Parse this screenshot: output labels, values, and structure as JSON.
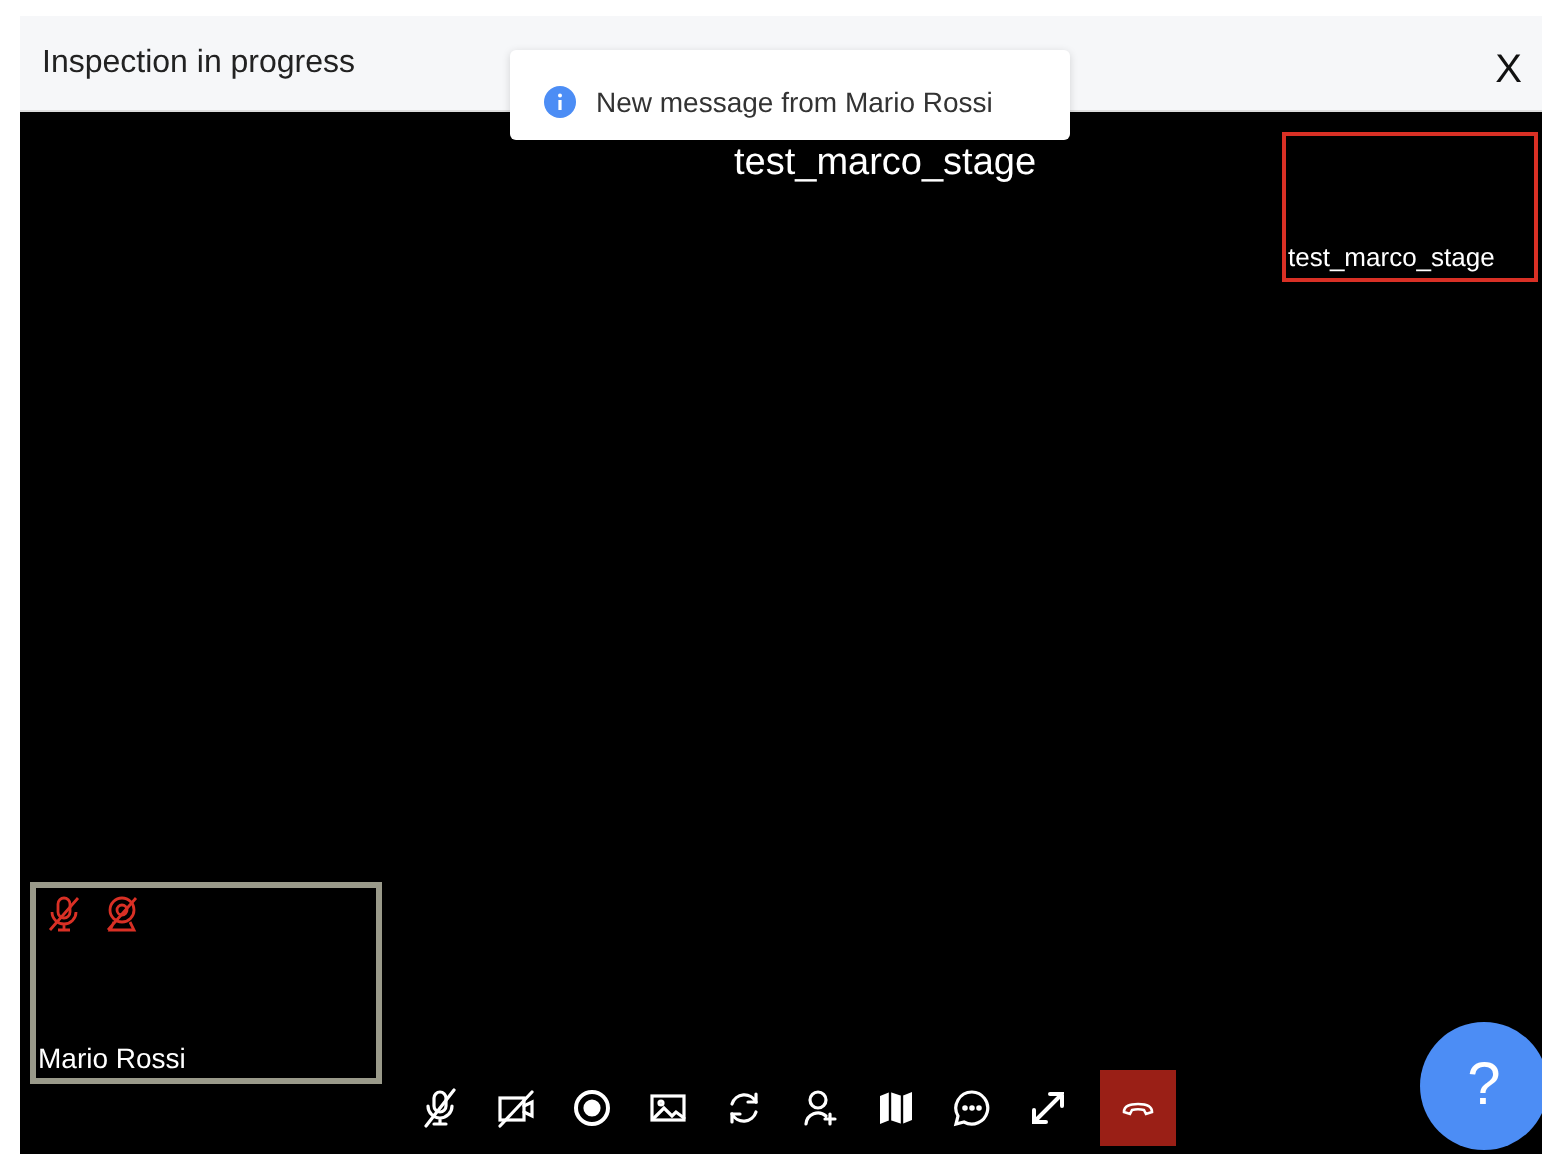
{
  "window": {
    "title": "Inspection in progress",
    "close": "X"
  },
  "toast": {
    "message": "New message from Mario Rossi"
  },
  "main_video": {
    "name": "test_marco_stage"
  },
  "remote_tile": {
    "name": "test_marco_stage",
    "active": true
  },
  "local_tile": {
    "name": "Mario Rossi",
    "mic_muted": true,
    "camera_muted": true
  },
  "toolbar": [
    {
      "kind": "mic-off"
    },
    {
      "kind": "camera-off"
    },
    {
      "kind": "record"
    },
    {
      "kind": "image"
    },
    {
      "kind": "switch"
    },
    {
      "kind": "add-user"
    },
    {
      "kind": "map"
    },
    {
      "kind": "chat"
    },
    {
      "kind": "expand"
    },
    {
      "kind": "hangup"
    }
  ],
  "help": {
    "label": "?"
  }
}
